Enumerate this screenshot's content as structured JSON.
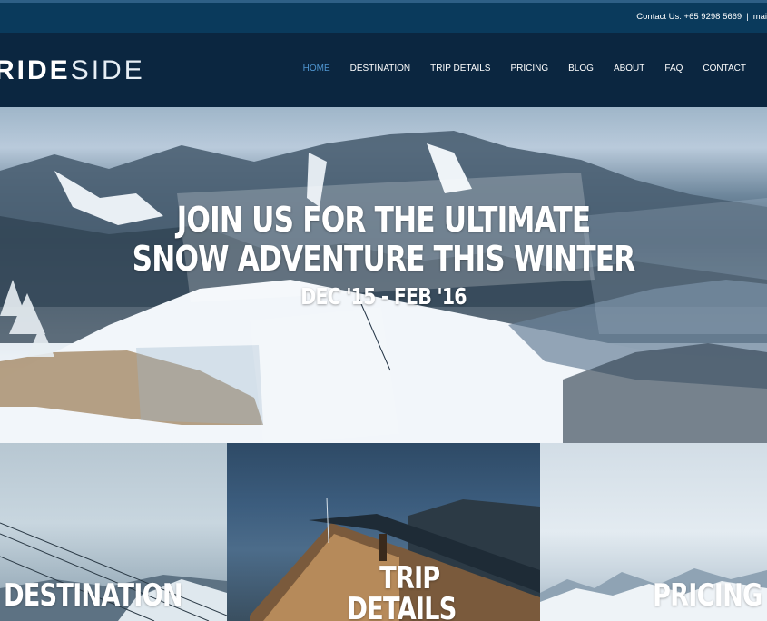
{
  "topbar": {
    "contact_label": "Contact Us: +65 9298 5669",
    "separator": "|",
    "extra": "mai"
  },
  "brand": {
    "bold": "RIDE",
    "light": "SIDE"
  },
  "nav": {
    "items": [
      "HOME",
      "DESTINATION",
      "TRIP DETAILS",
      "PRICING",
      "BLOG",
      "ABOUT",
      "FAQ",
      "CONTACT"
    ],
    "active": "HOME"
  },
  "hero": {
    "line1": "JOIN US FOR THE ULTIMATE",
    "line2": "SNOW ADVENTURE THIS WINTER",
    "dates": "DEC '15 - FEB '16"
  },
  "tiles": {
    "destination": "DESTINATION",
    "trip_line1": "TRIP",
    "trip_line2": "DETAILS",
    "pricing": "PRICING"
  },
  "colors": {
    "nav_active": "#4f95cf",
    "header_bg": "#0b2640",
    "topbar_bg": "#0a3a5c"
  }
}
